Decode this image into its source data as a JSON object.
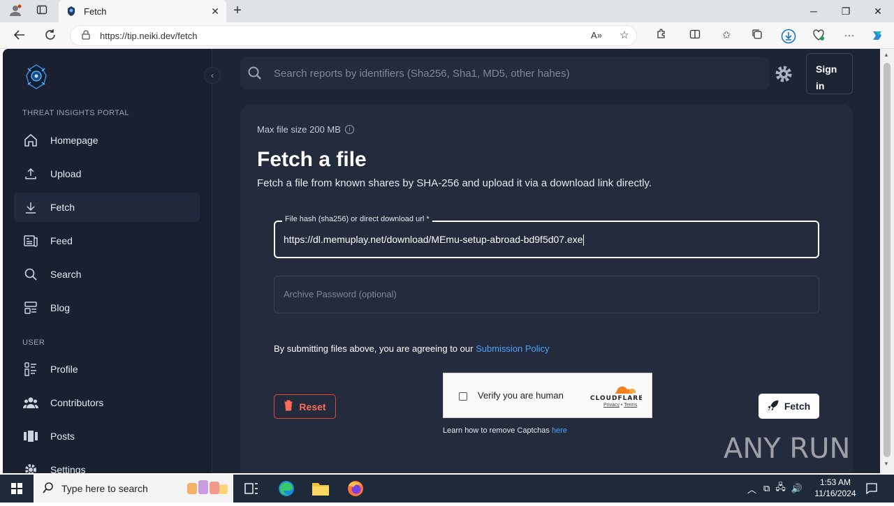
{
  "browser": {
    "tab_title": "Fetch",
    "url": "https://tip.neiki.dev/fetch"
  },
  "sidebar": {
    "sections": [
      {
        "label": "THREAT INSIGHTS PORTAL"
      },
      {
        "label": "USER"
      }
    ],
    "items": [
      {
        "label": "Homepage"
      },
      {
        "label": "Upload"
      },
      {
        "label": "Fetch"
      },
      {
        "label": "Feed"
      },
      {
        "label": "Search"
      },
      {
        "label": "Blog"
      },
      {
        "label": "Profile"
      },
      {
        "label": "Contributors"
      },
      {
        "label": "Posts"
      },
      {
        "label": "Settings"
      }
    ]
  },
  "header": {
    "search_placeholder": "Search reports by identifiers (Sha256, Sha1, MD5, other hahes)",
    "signin_line1": "Sign",
    "signin_line2": "in"
  },
  "main": {
    "max_file_size": "Max file size 200 MB",
    "title": "Fetch a file",
    "subtitle": "Fetch a file from known shares by SHA-256 and upload it via a download link directly.",
    "hash_field_label": "File hash (sha256) or direct download url *",
    "hash_field_value": "https://dl.memuplay.net/download/MEmu-setup-abroad-bd9f5d07.exe",
    "password_placeholder": "Archive Password (optional)",
    "policy_text": "By submitting files above, you are agreeing to our",
    "policy_link": "Submission Policy",
    "reset_label": "Reset",
    "fetch_label": "Fetch",
    "captcha_text": "Verify you are human",
    "captcha_brand": "CLOUDFLARE",
    "captcha_privacy": "Privacy",
    "captcha_sep": "•",
    "captcha_terms": "Terms",
    "captcha_note": "Learn how to remove Captchas",
    "captcha_note_link": "here"
  },
  "watermark": "ANY RUN",
  "taskbar": {
    "search_placeholder": "Type here to search",
    "time": "1:53 AM",
    "date": "11/16/2024"
  },
  "colors": {
    "page_bg": "#1d2433",
    "card_bg": "#232b3c",
    "link": "#4aa3ff",
    "danger": "#e04a3a"
  }
}
